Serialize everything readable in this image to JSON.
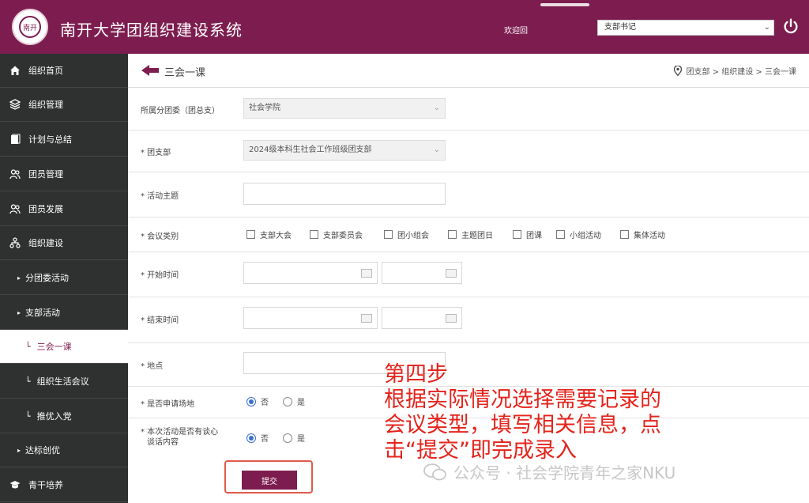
{
  "header": {
    "logo_text": "南开",
    "title": "南开大学团组织建设系统",
    "welcome": "欢迎回",
    "role_select_value": "支部书记"
  },
  "sidebar": {
    "items": [
      {
        "label": "组织首页",
        "icon": "home-icon"
      },
      {
        "label": "组织管理",
        "icon": "layers-icon"
      },
      {
        "label": "计划与总结",
        "icon": "book-icon"
      },
      {
        "label": "团员管理",
        "icon": "users-icon"
      },
      {
        "label": "团员发展",
        "icon": "users-icon"
      },
      {
        "label": "组织建设",
        "icon": "org-chart-icon"
      },
      {
        "label": "分团委活动"
      },
      {
        "label": "支部活动"
      },
      {
        "label": "三会一课"
      },
      {
        "label": "组织生活会议"
      },
      {
        "label": "推优入党"
      },
      {
        "label": "达标创优"
      },
      {
        "label": "青干培养",
        "icon": "graduation-cap-icon"
      }
    ]
  },
  "page": {
    "title": "三会一课",
    "breadcrumb": "团支部 > 组织建设 > 三会一课"
  },
  "form": {
    "branch_committee_label": "所属分团委（团总支）",
    "branch_committee_value": "社会学院",
    "branch_label": "* 团支部",
    "branch_value": "2024级本科生社会工作班级团支部",
    "theme_label": "* 活动主题",
    "meeting_type_label": "* 会议类别",
    "meeting_types": [
      "支部大会",
      "支部委员会",
      "团小组会",
      "主题团日",
      "团课",
      "小组活动",
      "集体活动"
    ],
    "start_time_label": "* 开始时间",
    "end_time_label": "* 结束时间",
    "place_label": "* 地点",
    "apply_venue_label": "* 是否申请场地",
    "record_label_line1": "* 本次活动是否有谈心",
    "record_label_line2": "谈话内容",
    "radio_no": "否",
    "radio_yes": "是",
    "submit_label": "提交"
  },
  "annotation": {
    "lines": [
      "第四步",
      "根据实际情况选择需要记录的",
      "会议类型，填写相关信息，点",
      "击“提交”即完成录入"
    ]
  },
  "watermark": {
    "text": "公众号 · 社会学院青年之家NKU"
  },
  "colors": {
    "brand": "#7d1d4f",
    "sidebar": "#2f3131",
    "annotation": "#e4231b"
  }
}
